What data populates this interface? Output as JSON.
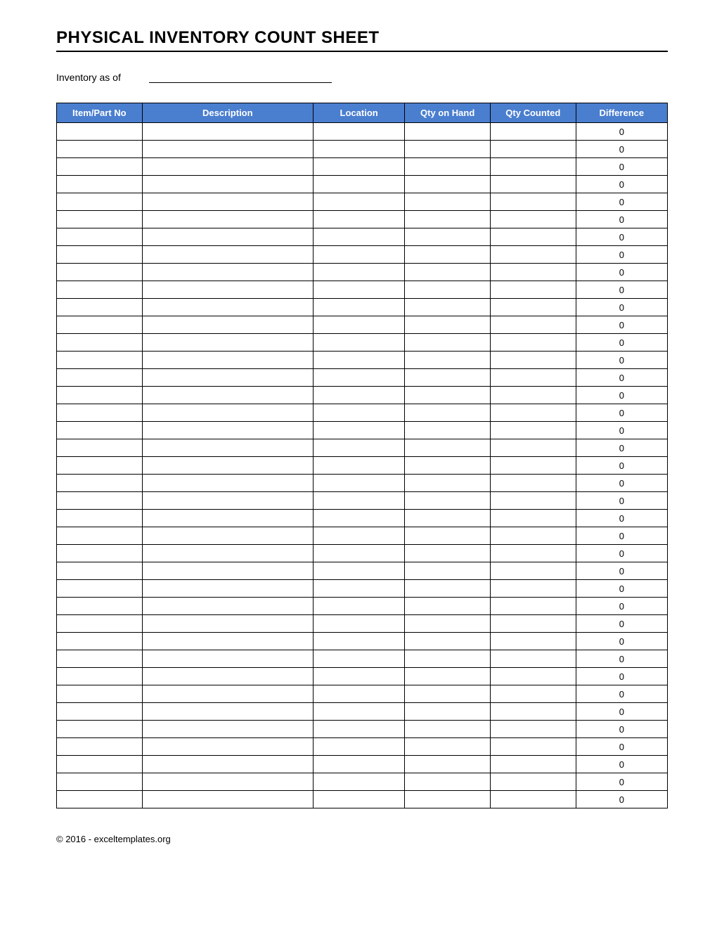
{
  "title": "PHYSICAL INVENTORY COUNT SHEET",
  "meta": {
    "label": "Inventory as of",
    "value": ""
  },
  "columns": [
    "Item/Part No",
    "Description",
    "Location",
    "Qty on Hand",
    "Qty Counted",
    "Difference"
  ],
  "rows": [
    {
      "item": "",
      "desc": "",
      "loc": "",
      "onhand": "",
      "counted": "",
      "diff": "0"
    },
    {
      "item": "",
      "desc": "",
      "loc": "",
      "onhand": "",
      "counted": "",
      "diff": "0"
    },
    {
      "item": "",
      "desc": "",
      "loc": "",
      "onhand": "",
      "counted": "",
      "diff": "0"
    },
    {
      "item": "",
      "desc": "",
      "loc": "",
      "onhand": "",
      "counted": "",
      "diff": "0"
    },
    {
      "item": "",
      "desc": "",
      "loc": "",
      "onhand": "",
      "counted": "",
      "diff": "0"
    },
    {
      "item": "",
      "desc": "",
      "loc": "",
      "onhand": "",
      "counted": "",
      "diff": "0"
    },
    {
      "item": "",
      "desc": "",
      "loc": "",
      "onhand": "",
      "counted": "",
      "diff": "0"
    },
    {
      "item": "",
      "desc": "",
      "loc": "",
      "onhand": "",
      "counted": "",
      "diff": "0"
    },
    {
      "item": "",
      "desc": "",
      "loc": "",
      "onhand": "",
      "counted": "",
      "diff": "0"
    },
    {
      "item": "",
      "desc": "",
      "loc": "",
      "onhand": "",
      "counted": "",
      "diff": "0"
    },
    {
      "item": "",
      "desc": "",
      "loc": "",
      "onhand": "",
      "counted": "",
      "diff": "0"
    },
    {
      "item": "",
      "desc": "",
      "loc": "",
      "onhand": "",
      "counted": "",
      "diff": "0"
    },
    {
      "item": "",
      "desc": "",
      "loc": "",
      "onhand": "",
      "counted": "",
      "diff": "0"
    },
    {
      "item": "",
      "desc": "",
      "loc": "",
      "onhand": "",
      "counted": "",
      "diff": "0"
    },
    {
      "item": "",
      "desc": "",
      "loc": "",
      "onhand": "",
      "counted": "",
      "diff": "0"
    },
    {
      "item": "",
      "desc": "",
      "loc": "",
      "onhand": "",
      "counted": "",
      "diff": "0"
    },
    {
      "item": "",
      "desc": "",
      "loc": "",
      "onhand": "",
      "counted": "",
      "diff": "0"
    },
    {
      "item": "",
      "desc": "",
      "loc": "",
      "onhand": "",
      "counted": "",
      "diff": "0"
    },
    {
      "item": "",
      "desc": "",
      "loc": "",
      "onhand": "",
      "counted": "",
      "diff": "0"
    },
    {
      "item": "",
      "desc": "",
      "loc": "",
      "onhand": "",
      "counted": "",
      "diff": "0"
    },
    {
      "item": "",
      "desc": "",
      "loc": "",
      "onhand": "",
      "counted": "",
      "diff": "0"
    },
    {
      "item": "",
      "desc": "",
      "loc": "",
      "onhand": "",
      "counted": "",
      "diff": "0"
    },
    {
      "item": "",
      "desc": "",
      "loc": "",
      "onhand": "",
      "counted": "",
      "diff": "0"
    },
    {
      "item": "",
      "desc": "",
      "loc": "",
      "onhand": "",
      "counted": "",
      "diff": "0"
    },
    {
      "item": "",
      "desc": "",
      "loc": "",
      "onhand": "",
      "counted": "",
      "diff": "0"
    },
    {
      "item": "",
      "desc": "",
      "loc": "",
      "onhand": "",
      "counted": "",
      "diff": "0"
    },
    {
      "item": "",
      "desc": "",
      "loc": "",
      "onhand": "",
      "counted": "",
      "diff": "0"
    },
    {
      "item": "",
      "desc": "",
      "loc": "",
      "onhand": "",
      "counted": "",
      "diff": "0"
    },
    {
      "item": "",
      "desc": "",
      "loc": "",
      "onhand": "",
      "counted": "",
      "diff": "0"
    },
    {
      "item": "",
      "desc": "",
      "loc": "",
      "onhand": "",
      "counted": "",
      "diff": "0"
    },
    {
      "item": "",
      "desc": "",
      "loc": "",
      "onhand": "",
      "counted": "",
      "diff": "0"
    },
    {
      "item": "",
      "desc": "",
      "loc": "",
      "onhand": "",
      "counted": "",
      "diff": "0"
    },
    {
      "item": "",
      "desc": "",
      "loc": "",
      "onhand": "",
      "counted": "",
      "diff": "0"
    },
    {
      "item": "",
      "desc": "",
      "loc": "",
      "onhand": "",
      "counted": "",
      "diff": "0"
    },
    {
      "item": "",
      "desc": "",
      "loc": "",
      "onhand": "",
      "counted": "",
      "diff": "0"
    },
    {
      "item": "",
      "desc": "",
      "loc": "",
      "onhand": "",
      "counted": "",
      "diff": "0"
    },
    {
      "item": "",
      "desc": "",
      "loc": "",
      "onhand": "",
      "counted": "",
      "diff": "0"
    },
    {
      "item": "",
      "desc": "",
      "loc": "",
      "onhand": "",
      "counted": "",
      "diff": "0"
    },
    {
      "item": "",
      "desc": "",
      "loc": "",
      "onhand": "",
      "counted": "",
      "diff": "0"
    }
  ],
  "footer": "© 2016 - exceltemplates.org"
}
